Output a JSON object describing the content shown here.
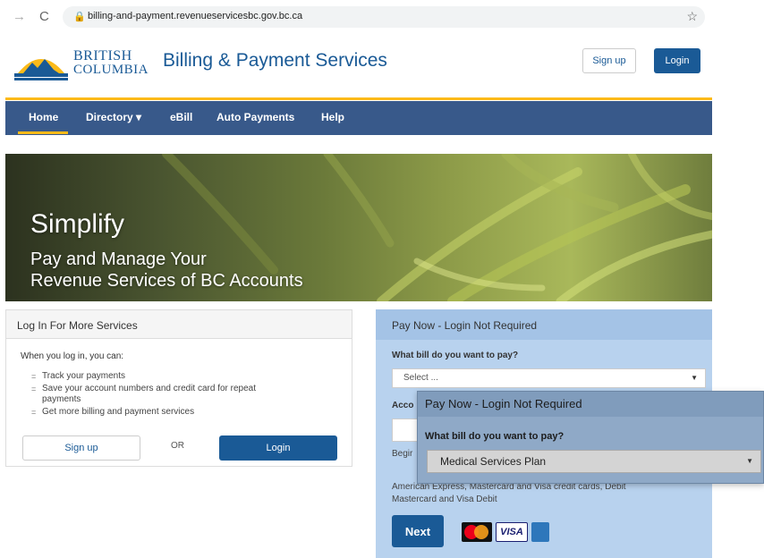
{
  "browser": {
    "url": "billing-and-payment.revenueservicesbc.gov.bc.ca",
    "back_icon": "→",
    "reload_icon": "C",
    "star_icon": "☆"
  },
  "header": {
    "logo_line1": "BRITISH",
    "logo_line2": "COLUMBIA",
    "title": "Billing & Payment Services",
    "signup_label": "Sign up",
    "login_label": "Login"
  },
  "nav": {
    "items": [
      "Home",
      "Directory ▾",
      "eBill",
      "Auto Payments",
      "Help"
    ]
  },
  "hero": {
    "headline": "Simplify",
    "subline1": "Pay and Manage Your",
    "subline2": "Revenue Services of BC Accounts"
  },
  "login_panel": {
    "title": "Log In For More Services",
    "intro": "When you log in, you can:",
    "bullets": [
      "Track your payments",
      "Save your account numbers and credit card for repeat",
      "payments",
      "Get more billing and payment services"
    ],
    "signup_label": "Sign up",
    "or_label": "OR",
    "login_label": "Login"
  },
  "pay_panel": {
    "title": "Pay Now - Login Not Required",
    "question": "What bill do you want to pay?",
    "select_placeholder": "Select ...",
    "account_label": "Acco",
    "begin_label": "Begir",
    "cards_line1": "American Express, Mastercard and Visa credit cards, Debit",
    "cards_line2": "Mastercard and Visa Debit",
    "next_label": "Next",
    "visa_label": "VISA"
  },
  "overlay": {
    "title": "Pay Now - Login Not Required",
    "question": "What bill do you want to pay?",
    "selected": "Medical Services Plan"
  },
  "colors": {
    "bc_blue": "#1a5a96",
    "nav_blue": "#38598a",
    "bc_gold": "#fcba19",
    "pay_panel_bg": "#b8d2ee"
  }
}
